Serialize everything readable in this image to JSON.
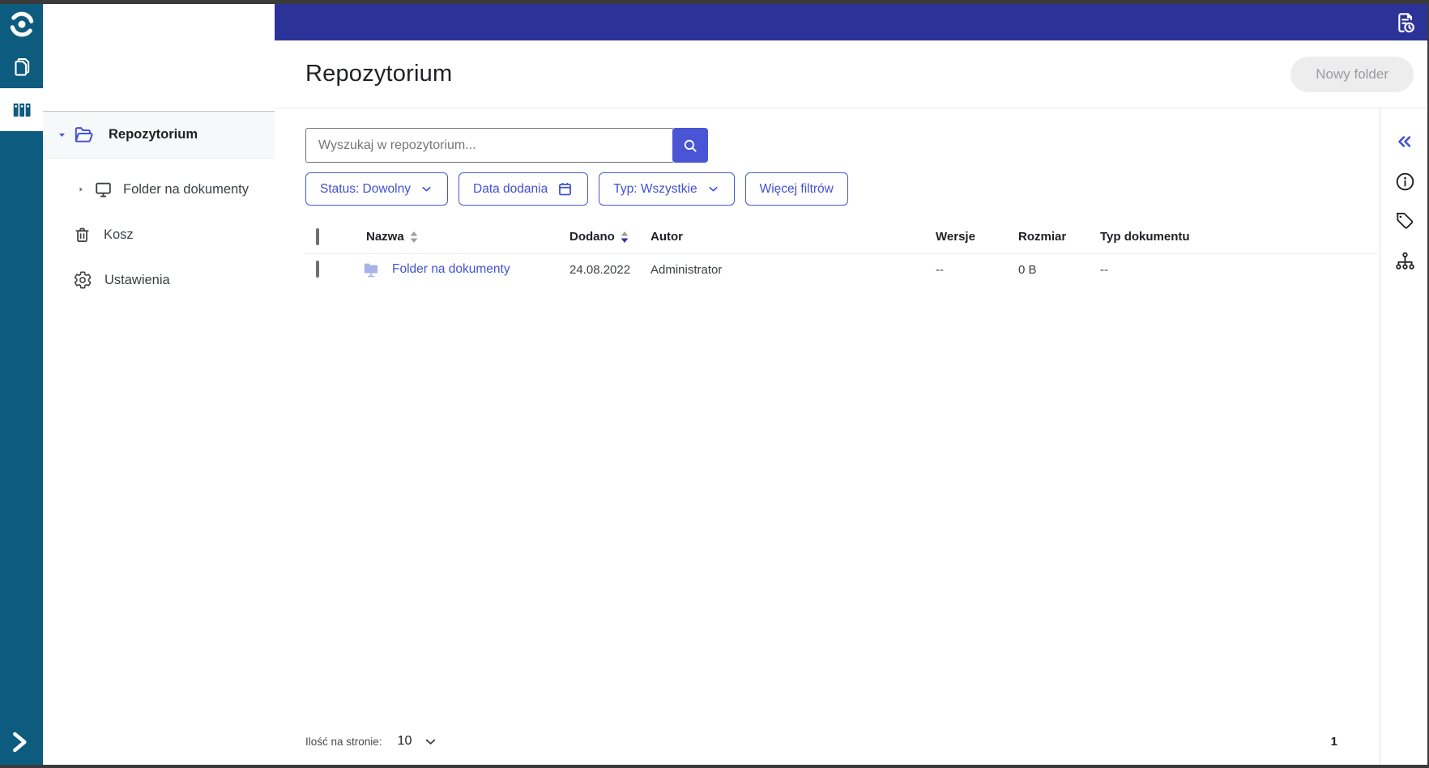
{
  "rail": {
    "logo_icon": "swirl-logo-icon",
    "items": [
      {
        "icon": "documents-icon",
        "active": false
      },
      {
        "icon": "binders-icon",
        "active": true
      }
    ],
    "expand_icon": "chevron-right-icon"
  },
  "topbar": {
    "right_icon": "document-history-icon",
    "color": "#2b3398"
  },
  "sidebar": {
    "items": [
      {
        "label": "Repozytorium",
        "icon": "folder-open-icon",
        "caret": "down",
        "selected": true
      },
      {
        "label": "Folder na dokumenty",
        "icon": "shared-folder-icon",
        "caret": "right",
        "selected": false
      },
      {
        "label": "Kosz",
        "icon": "trash-icon",
        "selected": false
      },
      {
        "label": "Ustawienia",
        "icon": "gear-icon",
        "selected": false
      }
    ]
  },
  "header": {
    "title": "Repozytorium",
    "new_folder_label": "Nowy folder"
  },
  "search": {
    "placeholder": "Wyszukaj w repozytorium...",
    "button_icon": "search-icon"
  },
  "filters": [
    {
      "label": "Status: Dowolny",
      "icon": "chevron-down-icon"
    },
    {
      "label": "Data dodania",
      "icon": "calendar-icon"
    },
    {
      "label": "Typ: Wszystkie",
      "icon": "chevron-down-icon"
    },
    {
      "label": "Więcej filtrów",
      "icon": ""
    }
  ],
  "table": {
    "columns": [
      {
        "label": "Nazwa",
        "sortable": true,
        "sorted": "none"
      },
      {
        "label": "Dodano",
        "sortable": true,
        "sorted": "desc"
      },
      {
        "label": "Autor"
      },
      {
        "label": "Wersje"
      },
      {
        "label": "Rozmiar"
      },
      {
        "label": "Typ dokumentu"
      }
    ],
    "rows": [
      {
        "icon": "folder-stand-icon",
        "name": "Folder na dokumenty",
        "added": "24.08.2022",
        "author": "Administrator",
        "versions": "--",
        "size": "0 B",
        "doc_type": "--"
      }
    ]
  },
  "right_panel": {
    "icons": [
      "collapse-double-chevron-icon",
      "info-icon",
      "tag-icon",
      "hierarchy-icon"
    ]
  },
  "pagination": {
    "per_page_label": "Ilość na stronie:",
    "per_page_value": "10",
    "current_page": "1"
  },
  "colors": {
    "topbar": "#2b3398",
    "rail": "#0d5b7e",
    "accent": "#4857d4",
    "link": "#4353d4",
    "row_icon": "#a9b3e8",
    "new_folder_bg": "#ededed",
    "new_folder_text": "#9b9ba0"
  }
}
